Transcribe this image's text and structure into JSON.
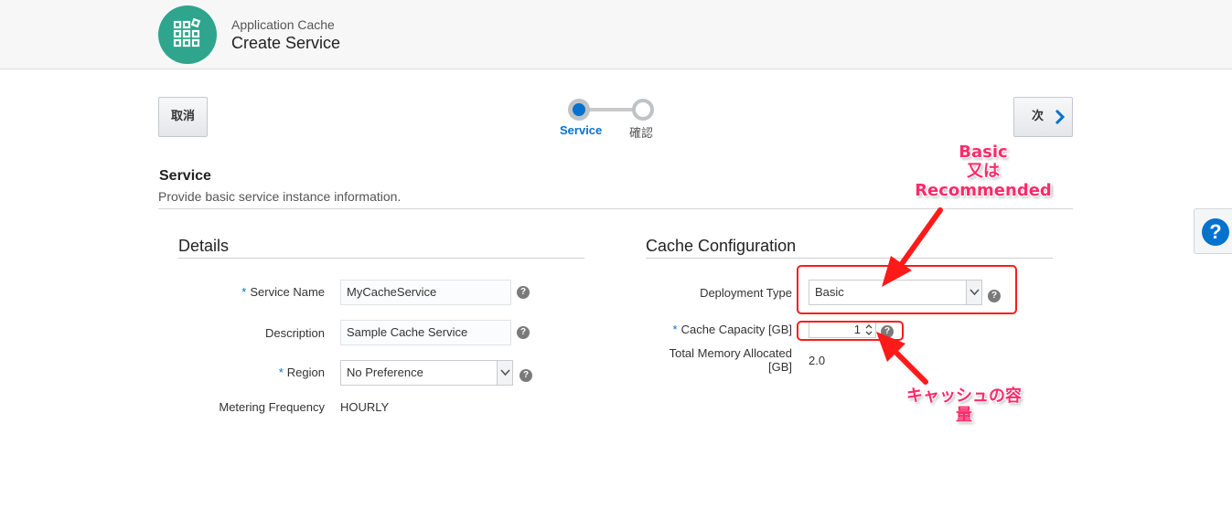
{
  "header": {
    "app_subtitle": "Application Cache",
    "app_title": "Create Service",
    "logo_icon": "grid-apps-icon"
  },
  "toolbar": {
    "cancel_label": "取消",
    "next_label": "次"
  },
  "train": {
    "steps": [
      {
        "label": "Service",
        "state": "current"
      },
      {
        "label": "確認",
        "state": "pending"
      }
    ]
  },
  "section": {
    "title": "Service",
    "description": "Provide basic service instance information."
  },
  "details": {
    "title": "Details",
    "service_name_label": "Service Name",
    "service_name_value": "MyCacheService",
    "description_label": "Description",
    "description_value": "Sample Cache Service",
    "region_label": "Region",
    "region_value": "No Preference",
    "metering_label": "Metering Frequency",
    "metering_value": "HOURLY",
    "required_marker": "*"
  },
  "cache": {
    "title": "Cache Configuration",
    "deployment_label": "Deployment Type",
    "deployment_value": "Basic",
    "capacity_label": "Cache Capacity [GB]",
    "capacity_value": "1",
    "memory_label_line1": "Total Memory Allocated",
    "memory_label_line2": "[GB]",
    "memory_value": "2.0"
  },
  "help_glyph": "?",
  "annotations": {
    "deployment_note_line1": "Basic",
    "deployment_note_line2": "又は",
    "deployment_note_line3": "Recommended",
    "capacity_note": "キャッシュの容量",
    "color": "#ff1a1a"
  },
  "colors": {
    "accent": "#0572ce",
    "brand": "#2ea58c"
  }
}
